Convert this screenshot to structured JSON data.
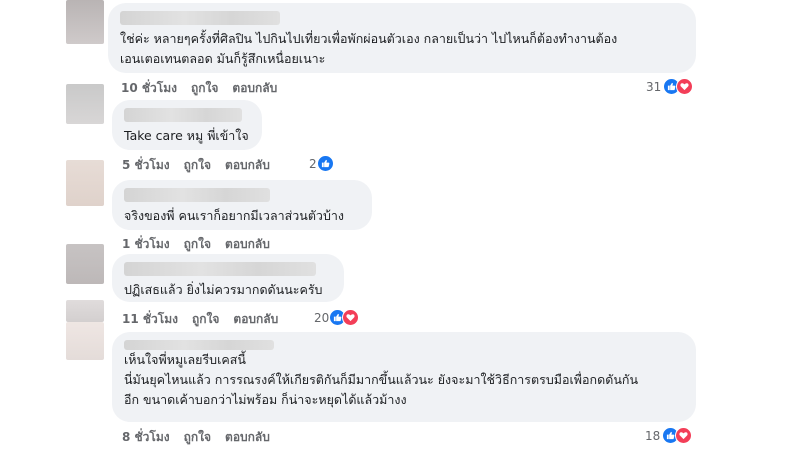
{
  "comments": [
    {
      "text": "ใช่ค่ะ หลายๆครั้งที่ศิลปิน ไปกินไปเที่ยวเพื่อพักผ่อนตัวเอง กลายเป็นว่า ไปไหนก็ต้องทำงานต้อง\nเอนเตอเทนตลอด มันก็รู้สึกเหนื่อยเนาะ",
      "time": "10 ชั่วโมง",
      "like": "ถูกใจ",
      "reply": "ตอบกลับ",
      "reaction_count": "31",
      "reactions": [
        "like-icon",
        "love-icon"
      ]
    },
    {
      "text": "Take care หมู พี่เข้าใจ",
      "time": "5 ชั่วโมง",
      "like": "ถูกใจ",
      "reply": "ตอบกลับ",
      "reaction_count": "2",
      "reactions": [
        "like-icon"
      ]
    },
    {
      "text": "จริงของพี่ คนเราก็อยากมีเวลาส่วนตัวบ้าง",
      "time": "1 ชั่วโมง",
      "like": "ถูกใจ",
      "reply": "ตอบกลับ"
    },
    {
      "text": "ปฏิเสธแล้ว ยิ่งไม่ควรมากดดันนะครับ",
      "time": "11 ชั่วโมง",
      "like": "ถูกใจ",
      "reply": "ตอบกลับ",
      "reaction_count": "20",
      "reactions": [
        "like-icon",
        "love-icon"
      ]
    },
    {
      "text": "เห็นใจพี่หมูเลยรีบเคสนี้\nนี่มันยุคไหนแล้ว การรณรงค์ให้เกียรติกันก็มีมากขึ้นแล้วนะ ยังจะมาใช้วิธีการตรบมือเพื่อกดดันกัน\nอีก ขนาดเค้าบอกว่าไม่พร้อม ก็น่าจะหยุดได้แล้วม้างง",
      "time": "8 ชั่วโมง",
      "like": "ถูกใจ",
      "reply": "ตอบกลับ",
      "reaction_count": "18",
      "reactions": [
        "like-icon",
        "love-icon"
      ]
    }
  ],
  "colors": {
    "bubble": "#f0f2f5",
    "like": "#1877f2",
    "love": "#f33e58",
    "meta": "#65676b"
  }
}
